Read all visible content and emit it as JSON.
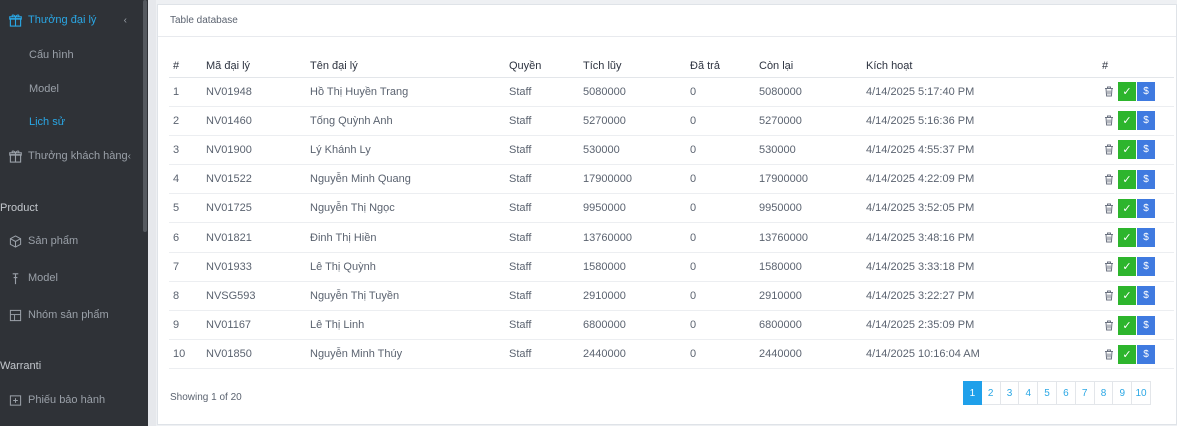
{
  "sidebar": {
    "items": [
      {
        "label": "Thưởng đại lý",
        "icon": "gift-icon",
        "active": true,
        "chevron": "‹"
      },
      {
        "label": "Thưởng khách hàng",
        "icon": "gift-icon",
        "chevron": "‹"
      }
    ],
    "sub_items": [
      {
        "label": "Cấu hình"
      },
      {
        "label": "Model"
      },
      {
        "label": "Lịch sử",
        "active": true
      }
    ],
    "sections": [
      {
        "header": "Product",
        "items": [
          {
            "label": "Sản phẩm",
            "icon": "cube-icon"
          },
          {
            "label": "Model",
            "icon": "hanger-icon"
          },
          {
            "label": "Nhóm sản phẩm",
            "icon": "grid-icon"
          }
        ]
      },
      {
        "header": "Warranti",
        "items": [
          {
            "label": "Phiếu bảo hành",
            "icon": "ticket-icon"
          }
        ]
      }
    ]
  },
  "card": {
    "title": "Table database"
  },
  "table": {
    "headers": [
      "#",
      "Mã đại lý",
      "Tên đại lý",
      "Quyền",
      "Tích lũy",
      "Đã trả",
      "Còn lại",
      "Kích hoạt",
      "#"
    ],
    "rows": [
      [
        "1",
        "NV01948",
        "Hồ Thị Huyền Trang",
        "Staff",
        "5080000",
        "0",
        "5080000",
        "4/14/2025 5:17:40 PM"
      ],
      [
        "2",
        "NV01460",
        "Tống Quỳnh Anh",
        "Staff",
        "5270000",
        "0",
        "5270000",
        "4/14/2025 5:16:36 PM"
      ],
      [
        "3",
        "NV01900",
        "Lý Khánh Ly",
        "Staff",
        "530000",
        "0",
        "530000",
        "4/14/2025 4:55:37 PM"
      ],
      [
        "4",
        "NV01522",
        "Nguyễn Minh Quang",
        "Staff",
        "17900000",
        "0",
        "17900000",
        "4/14/2025 4:22:09 PM"
      ],
      [
        "5",
        "NV01725",
        "Nguyễn Thị Ngọc",
        "Staff",
        "9950000",
        "0",
        "9950000",
        "4/14/2025 3:52:05 PM"
      ],
      [
        "6",
        "NV01821",
        "Đinh Thị Hiền",
        "Staff",
        "13760000",
        "0",
        "13760000",
        "4/14/2025 3:48:16 PM"
      ],
      [
        "7",
        "NV01933",
        "Lê Thị Quỳnh",
        "Staff",
        "1580000",
        "0",
        "1580000",
        "4/14/2025 3:33:18 PM"
      ],
      [
        "8",
        "NVSG593",
        "Nguyễn Thị Tuyền",
        "Staff",
        "2910000",
        "0",
        "2910000",
        "4/14/2025 3:22:27 PM"
      ],
      [
        "9",
        "NV01167",
        "Lê Thị Linh",
        "Staff",
        "6800000",
        "0",
        "6800000",
        "4/14/2025 2:35:09 PM"
      ],
      [
        "10",
        "NV01850",
        "Nguyễn Minh Thúy",
        "Staff",
        "2440000",
        "0",
        "2440000",
        "4/14/2025 10:16:04 AM"
      ]
    ],
    "actions": {
      "delete_icon": "trash-icon",
      "confirm_label": "✓",
      "pay_label": "$"
    }
  },
  "footer": {
    "showing": "Showing 1 of 20",
    "pages": [
      "1",
      "2",
      "3",
      "4",
      "5",
      "6",
      "7",
      "8",
      "9",
      "10"
    ],
    "current_page": "1"
  },
  "colors": {
    "sidebar_bg": "#2f3237",
    "accent": "#2aa7e5",
    "confirm": "#2db52d",
    "pay": "#3f7ae0"
  }
}
